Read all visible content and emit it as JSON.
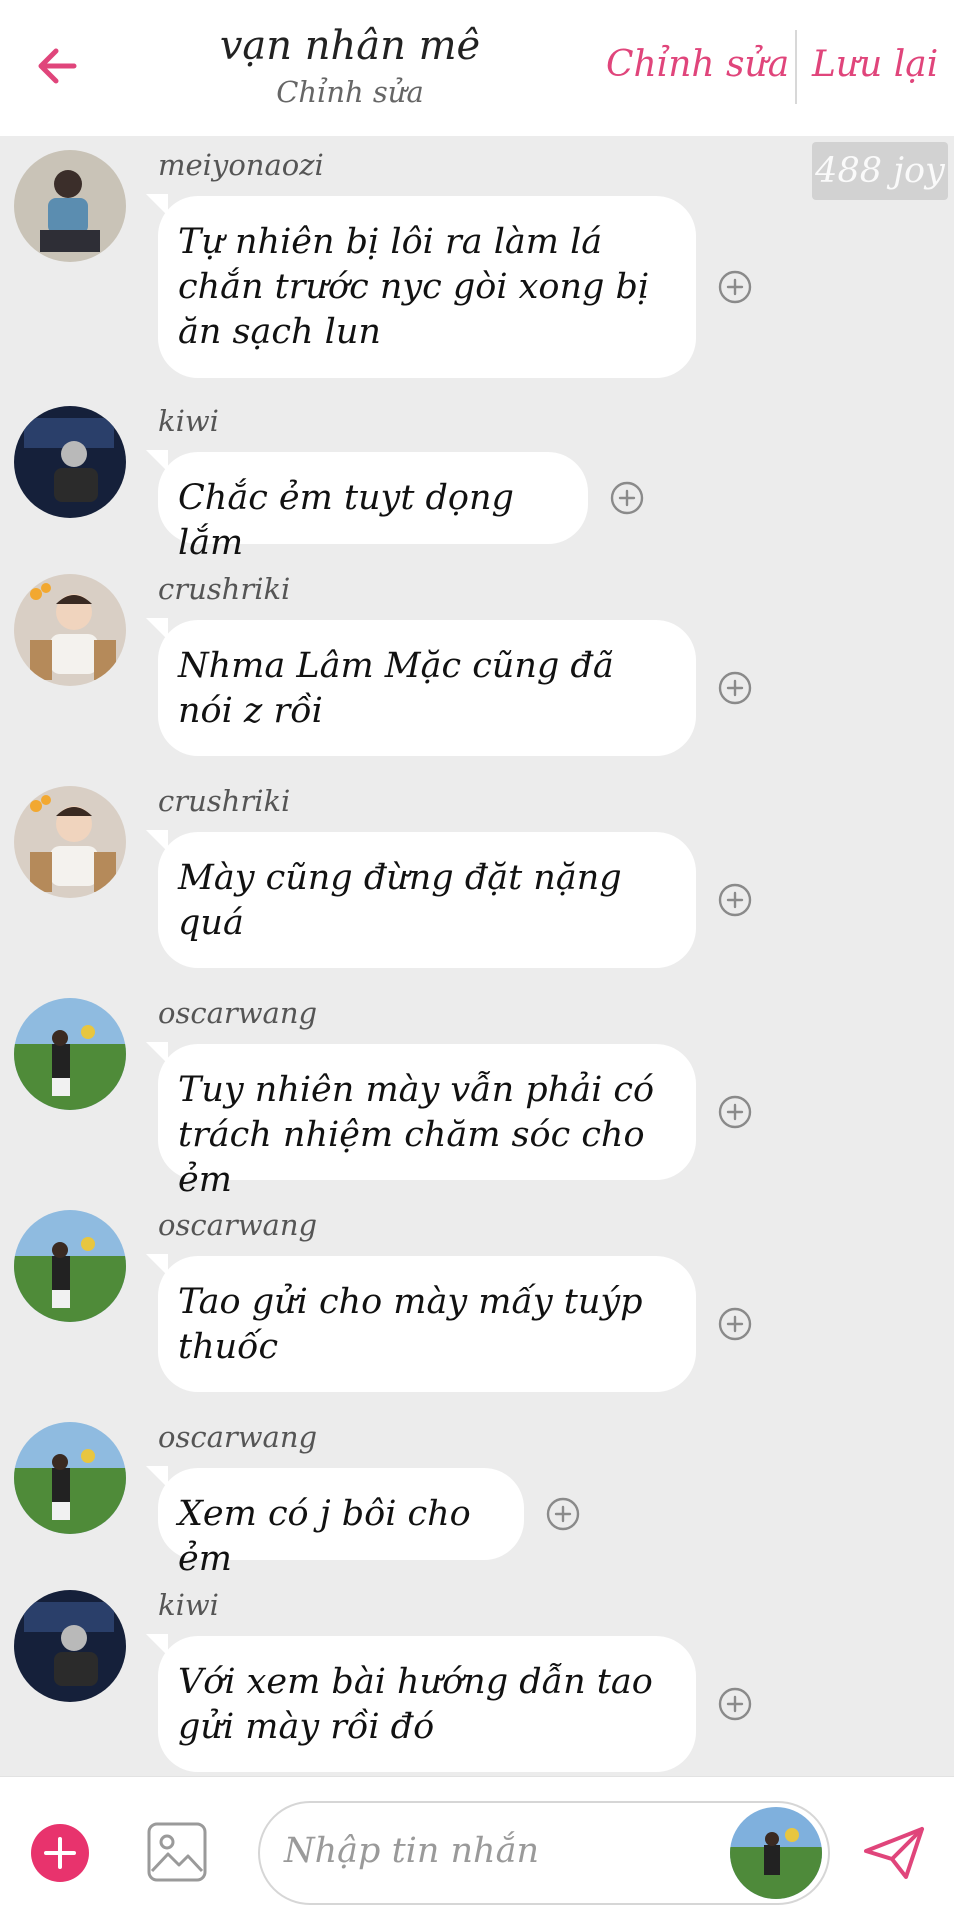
{
  "header": {
    "title": "vạn nhân mê",
    "subtitle": "Chỉnh sửa",
    "edit_label": "Chỉnh sửa",
    "save_label": "Lưu lại",
    "accent": "#e0457b"
  },
  "badge": {
    "text": "488 joy"
  },
  "messages": [
    {
      "sender": "meiyonaozi",
      "avatar": "avatar-meiyonaozi",
      "text": "Tự nhiên bị lôi ra làm lá chắn trước nyc gòi xong bị ăn sạch lun"
    },
    {
      "sender": "kiwi",
      "avatar": "avatar-kiwi",
      "text": "Chắc ẻm tuyt dọng lắm"
    },
    {
      "sender": "crushriki",
      "avatar": "avatar-crushriki",
      "text": "Nhma Lâm Mặc cũng đã nói z rồi"
    },
    {
      "sender": "crushriki",
      "avatar": "avatar-crushriki",
      "text": "Mày cũng đừng đặt nặng quá"
    },
    {
      "sender": "oscarwang",
      "avatar": "avatar-oscarwang",
      "text": "Tuy nhiên mày vẫn phải có trách nhiệm chăm sóc cho ẻm"
    },
    {
      "sender": "oscarwang",
      "avatar": "avatar-oscarwang",
      "text": "Tao gửi cho mày mấy tuýp thuốc"
    },
    {
      "sender": "oscarwang",
      "avatar": "avatar-oscarwang",
      "text": "Xem có j bôi cho ẻm"
    },
    {
      "sender": "kiwi",
      "avatar": "avatar-kiwi",
      "text": "Với xem bài hướng dẫn tao gửi mày rồi đó"
    }
  ],
  "composer": {
    "placeholder": "Nhập tin nhắn",
    "add_icon": "plus-circle-icon",
    "image_icon": "image-icon",
    "send_icon": "send-icon"
  },
  "colors": {
    "accent": "#e0457b",
    "chat_bg": "#ececec",
    "bubble": "#ffffff"
  }
}
